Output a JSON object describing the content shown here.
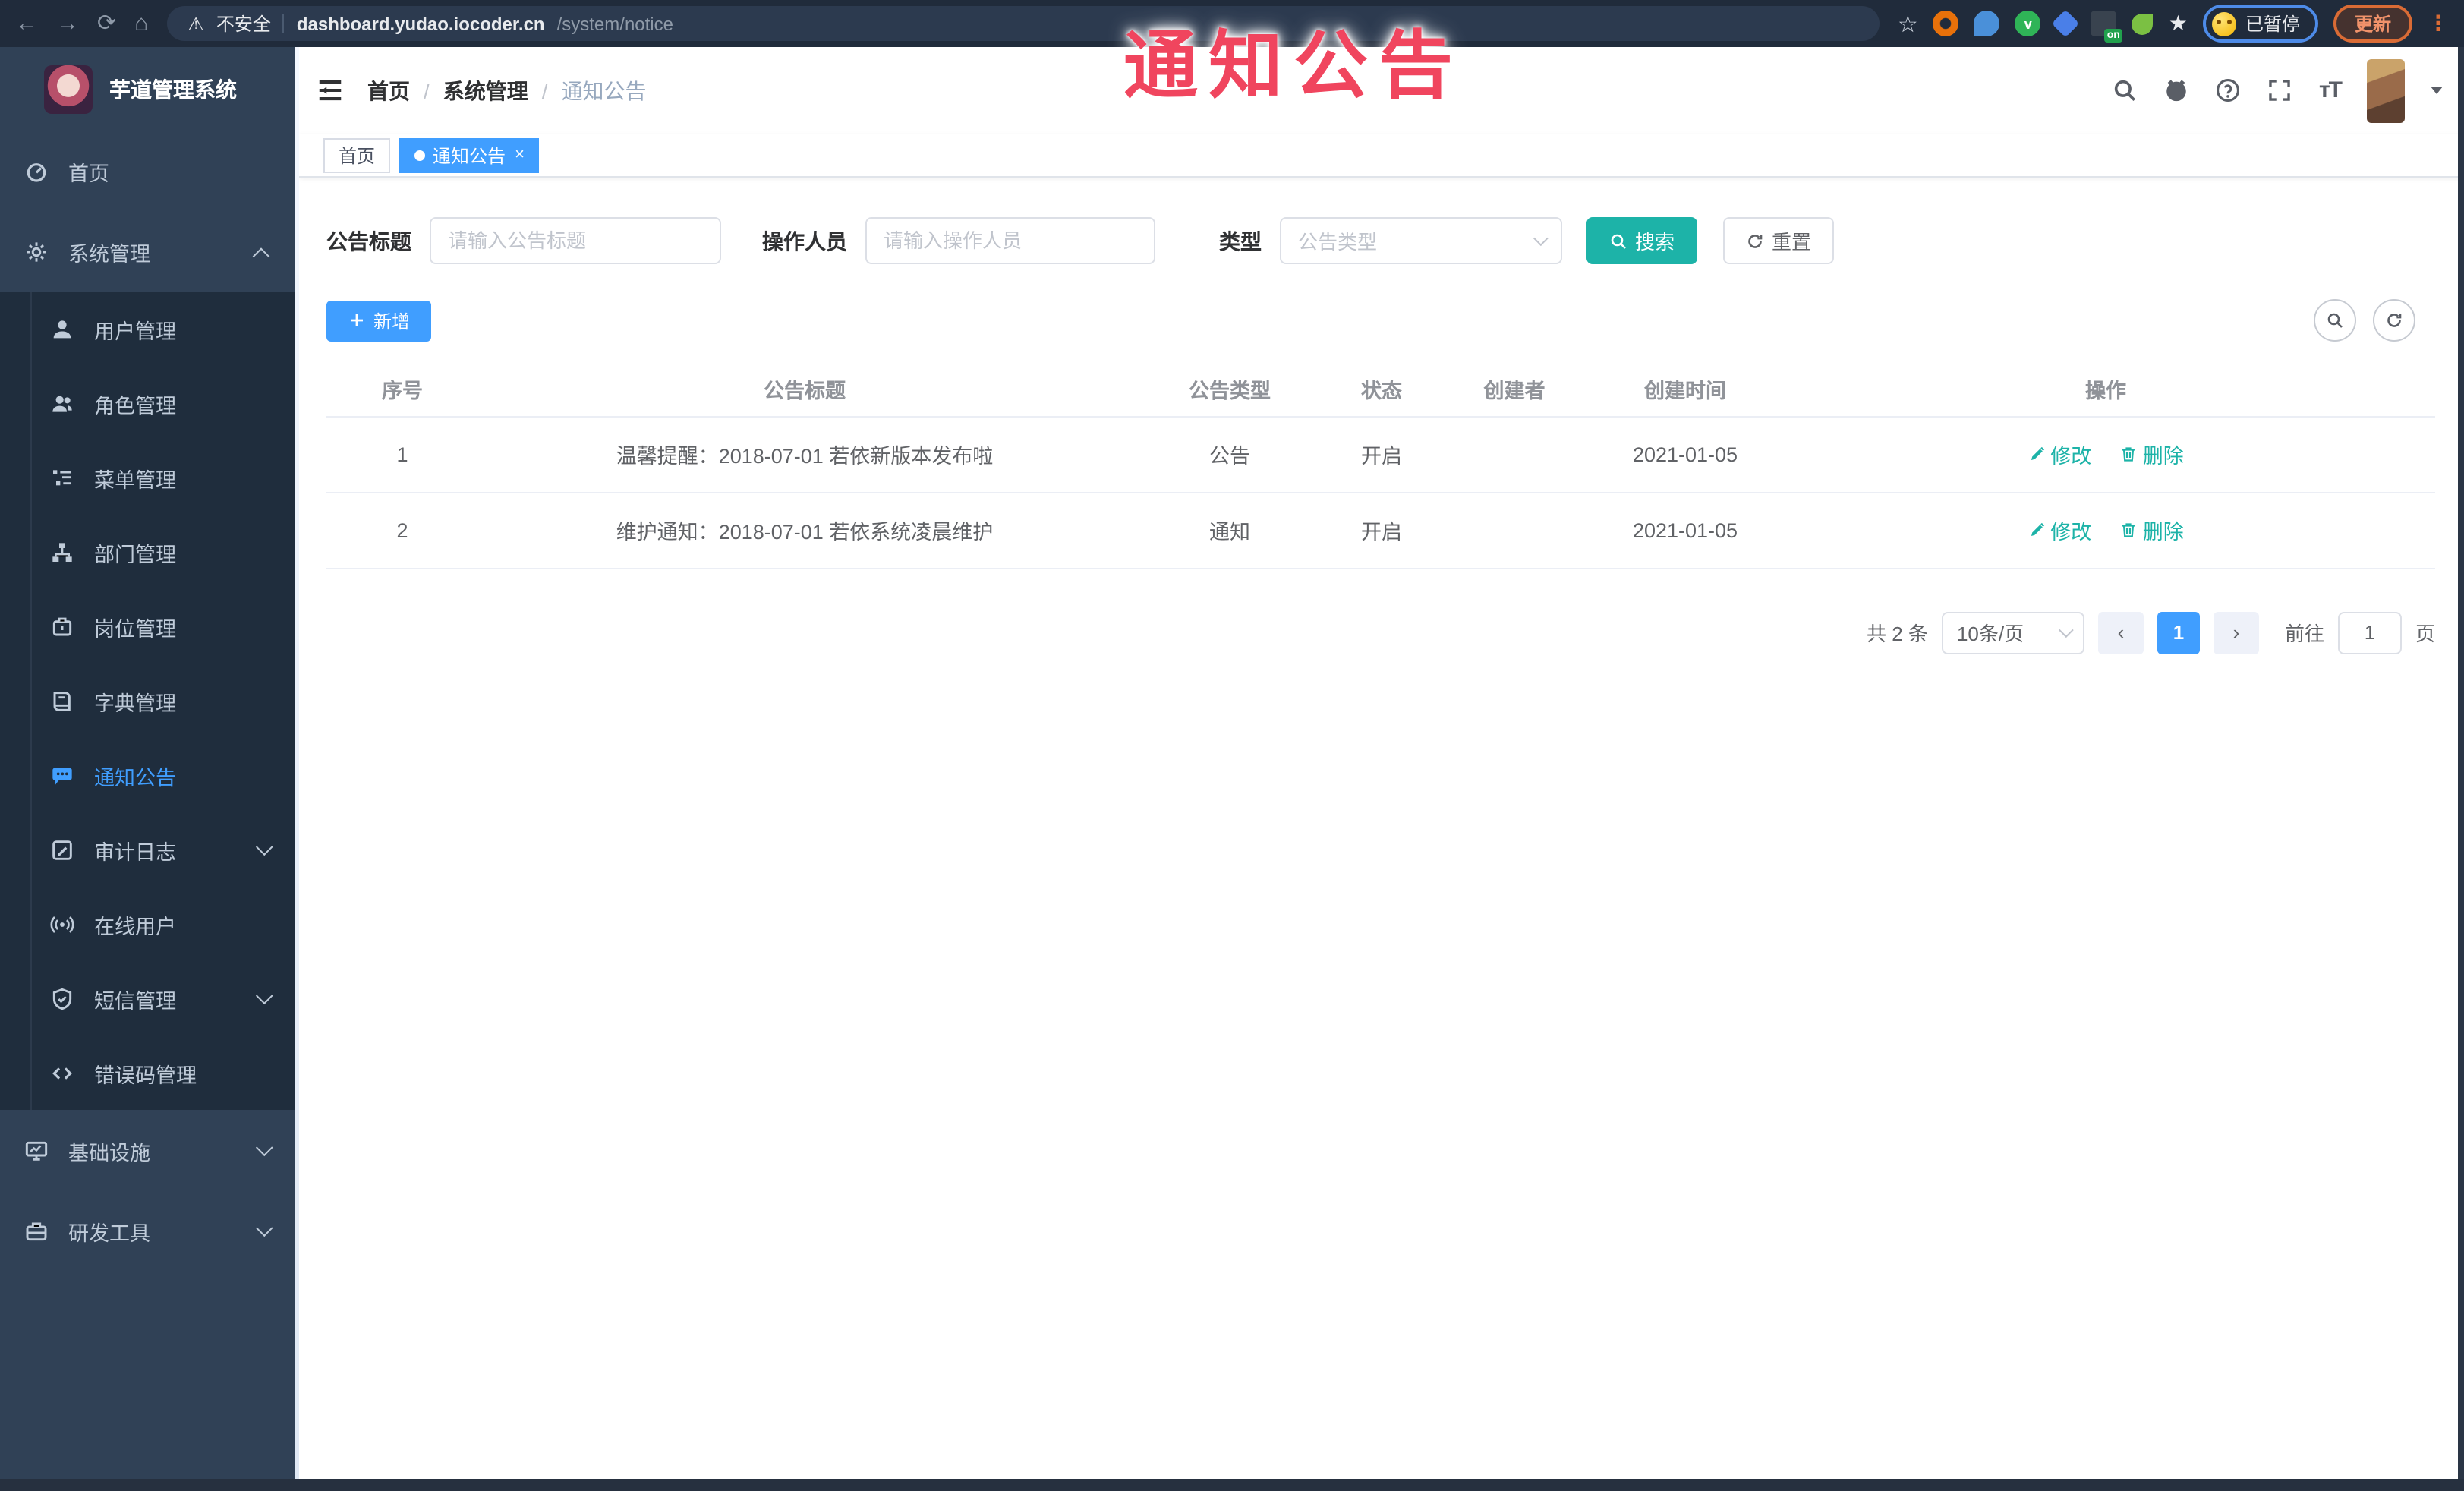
{
  "browser": {
    "security_label": "不安全",
    "url_host": "dashboard.yudao.iocoder.cn",
    "url_path": "/system/notice",
    "extension_badge": "on",
    "paused_label": "已暂停",
    "update_label": "更新"
  },
  "overlay": {
    "title": "通知公告",
    "color": "#f0455e"
  },
  "sidebar": {
    "logo_title": "芋道管理系统",
    "menu": [
      {
        "label": "首页"
      },
      {
        "label": "系统管理"
      },
      {
        "label": "用户管理"
      },
      {
        "label": "角色管理"
      },
      {
        "label": "菜单管理"
      },
      {
        "label": "部门管理"
      },
      {
        "label": "岗位管理"
      },
      {
        "label": "字典管理"
      },
      {
        "label": "通知公告"
      },
      {
        "label": "审计日志"
      },
      {
        "label": "在线用户"
      },
      {
        "label": "短信管理"
      },
      {
        "label": "错误码管理"
      },
      {
        "label": "基础设施"
      },
      {
        "label": "研发工具"
      }
    ]
  },
  "header": {
    "breadcrumb": [
      "首页",
      "系统管理",
      "通知公告"
    ]
  },
  "tabs": [
    {
      "label": "首页"
    },
    {
      "label": "通知公告"
    }
  ],
  "filters": {
    "title_label": "公告标题",
    "title_placeholder": "请输入公告标题",
    "operator_label": "操作人员",
    "operator_placeholder": "请输入操作人员",
    "type_label": "类型",
    "type_placeholder": "公告类型",
    "search_label": "搜索",
    "reset_label": "重置"
  },
  "toolbar": {
    "add_label": "新增"
  },
  "table": {
    "columns": [
      "序号",
      "公告标题",
      "公告类型",
      "状态",
      "创建者",
      "创建时间",
      "操作"
    ],
    "rows": [
      {
        "seq": "1",
        "title": "温馨提醒：2018-07-01 若依新版本发布啦",
        "type": "公告",
        "status": "开启",
        "creator": "",
        "created": "2021-01-05"
      },
      {
        "seq": "2",
        "title": "维护通知：2018-07-01 若依系统凌晨维护",
        "type": "通知",
        "status": "开启",
        "creator": "",
        "created": "2021-01-05"
      }
    ],
    "edit_label": "修改",
    "delete_label": "删除"
  },
  "pagination": {
    "total_label": "共 2 条",
    "page_size": "10条/页",
    "prev_label": "‹",
    "current_page": "1",
    "next_label": "›",
    "goto_label": "前往",
    "goto_value": "1",
    "page_label": "页"
  },
  "colors": {
    "accent": "#409eff",
    "teal": "#1db3a8",
    "sidebar_bg": "#304156",
    "submenu_bg": "#1f2d3d",
    "overlay_red": "#f0455e"
  }
}
